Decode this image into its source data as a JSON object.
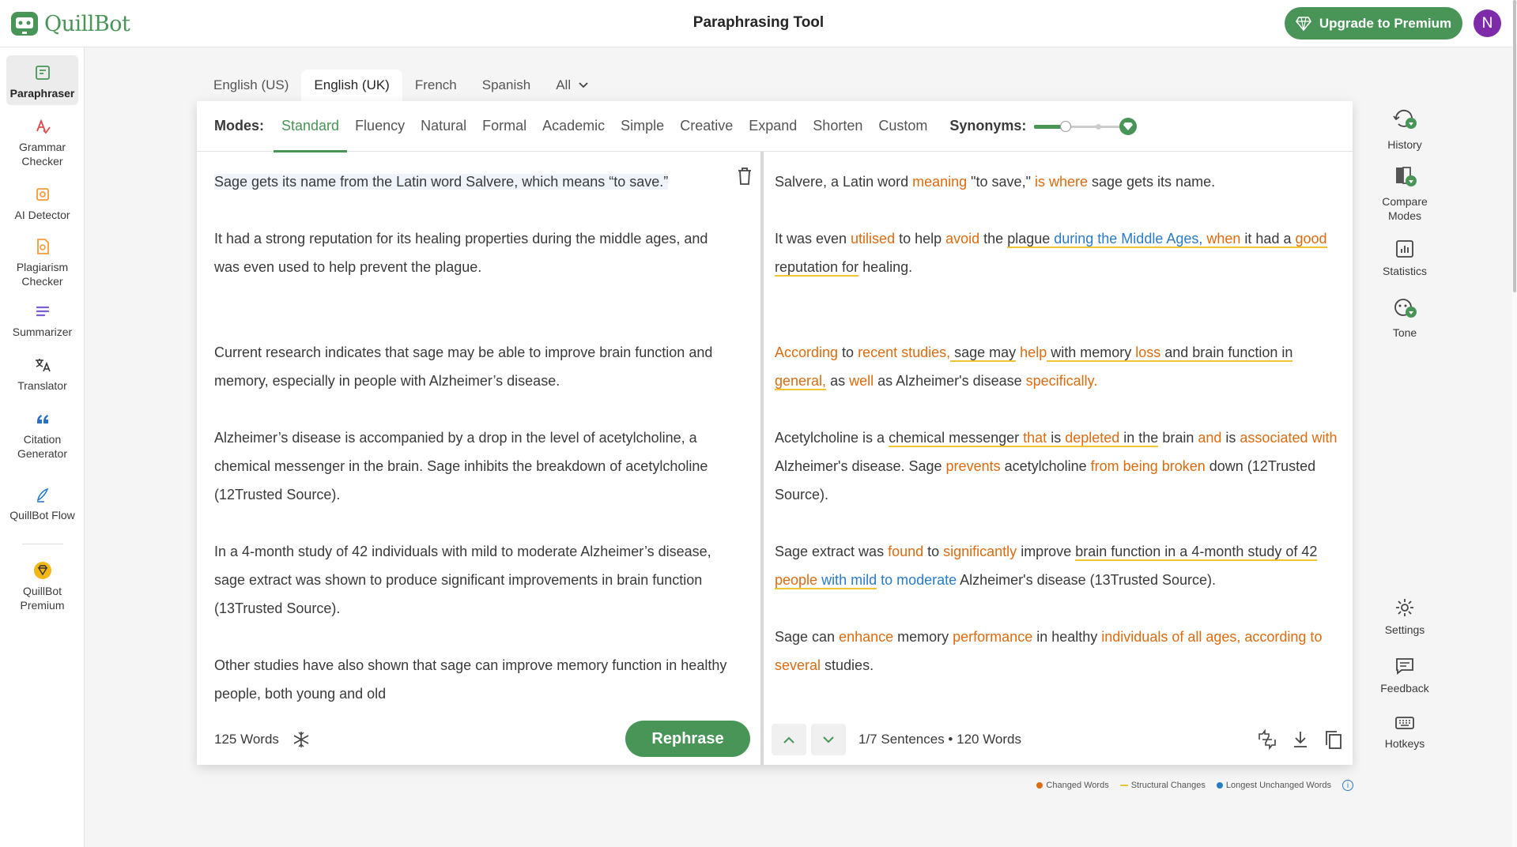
{
  "app": {
    "name": "QuillBot",
    "page_title": "Paraphrasing Tool",
    "upgrade_label": "Upgrade to Premium",
    "avatar_initial": "N",
    "brand_color": "#499557"
  },
  "sidebar": {
    "items": [
      {
        "label": "Paraphraser",
        "icon": "paraphraser-icon"
      },
      {
        "label": "Grammar Checker",
        "icon": "grammar-icon"
      },
      {
        "label": "AI Detector",
        "icon": "ai-detector-icon"
      },
      {
        "label": "Plagiarism Checker",
        "icon": "plagiarism-icon"
      },
      {
        "label": "Summarizer",
        "icon": "summarizer-icon"
      },
      {
        "label": "Translator",
        "icon": "translator-icon"
      },
      {
        "label": "Citation Generator",
        "icon": "citation-icon"
      },
      {
        "label": "QuillBot Flow",
        "icon": "flow-icon"
      },
      {
        "label": "QuillBot Premium",
        "icon": "premium-icon"
      }
    ]
  },
  "languages": {
    "tabs": [
      "English (US)",
      "English (UK)",
      "French",
      "Spanish"
    ],
    "active": "English (UK)",
    "all_label": "All"
  },
  "modes": {
    "label": "Modes:",
    "items": [
      "Standard",
      "Fluency",
      "Natural",
      "Formal",
      "Academic",
      "Simple",
      "Creative",
      "Expand",
      "Shorten",
      "Custom"
    ],
    "active": "Standard",
    "synonyms_label": "Synonyms:",
    "synonyms_level": 0.33
  },
  "input": {
    "paragraphs": [
      "Sage gets its name from the Latin word Salvere, which means “to save.”",
      "It had a strong reputation for its healing properties during the middle ages, and was even used to help prevent the plague.",
      "Current research indicates that sage may be able to improve brain function and memory, especially in people with Alzheimer’s disease.",
      "Alzheimer’s disease is accompanied by a drop in the level of acetylcholine, a chemical messenger in the brain. Sage inhibits the breakdown of acetylcholine (12Trusted Source).",
      "In a 4-month study of 42 individuals with mild to moderate Alzheimer’s disease, sage extract was shown to produce significant improvements in brain function (13Trusted Source).",
      "Other studies have also shown that sage can improve memory function in healthy people, both young and old"
    ],
    "word_count": "125 Words",
    "rephrase_label": "Rephrase"
  },
  "output": {
    "p1": {
      "a": "Salvere, a Latin word ",
      "b": "meaning",
      "c": " \"to save,\" ",
      "d": "is where",
      "e": " sage gets its name."
    },
    "p2": {
      "a": "It was even ",
      "b": "utilised",
      "c": " to help ",
      "d": "avoid",
      "e": " the ",
      "f": "plague ",
      "g": "during the Middle Ages,",
      "h": " when",
      "i": " it had a",
      "j": "good",
      "k": " reputation for",
      "l": " healing."
    },
    "p3": {
      "a": "According",
      "b": " to ",
      "c": "recent studies,",
      "d": " sage may",
      "e": " help",
      "f": " with memory ",
      "g": "loss",
      "h": " and brain function in",
      "i": "general,",
      "j": " as ",
      "k": "well",
      "l": " as Alzheimer's disease ",
      "m": "specifically."
    },
    "p4": {
      "a": "Acetylcholine is a ",
      "b": "chemical messenger",
      "c": " that",
      "d": " is ",
      "e": "depleted",
      "f": " in the",
      "g": " brain ",
      "h": "and",
      "i": " is ",
      "j": "associated with",
      "k": " Alzheimer's disease. Sage ",
      "l": "prevents",
      "m": " acetylcholine ",
      "n": "from being broken",
      "o": " down (12Trusted Source)."
    },
    "p5": {
      "a": "Sage extract was ",
      "b": "found",
      "c": " to ",
      "d": "significantly",
      "e": " improve ",
      "f": "brain function in a 4-month study of 42 ",
      "g": "people",
      "h": " with mild",
      "i": " to moderate",
      "j": " Alzheimer's disease (13Trusted Source)."
    },
    "p6": {
      "a": "Sage can ",
      "b": "enhance",
      "c": " memory ",
      "d": "performance",
      "e": " in healthy ",
      "f": "individuals of all ages, according to several",
      "g": " studies."
    },
    "sentences": "1/7 Sentences",
    "words": "120 Words"
  },
  "legend": {
    "changed": "Changed Words",
    "structural": "Structural Changes",
    "unchanged": "Longest Unchanged Words",
    "colors": {
      "changed": "#dd6b10",
      "structural": "#f1c232",
      "unchanged": "#2a7bc8"
    }
  },
  "right_tools": {
    "top": [
      "History",
      "Compare Modes",
      "Statistics",
      "Tone"
    ],
    "bottom": [
      "Settings",
      "Feedback",
      "Hotkeys"
    ]
  }
}
